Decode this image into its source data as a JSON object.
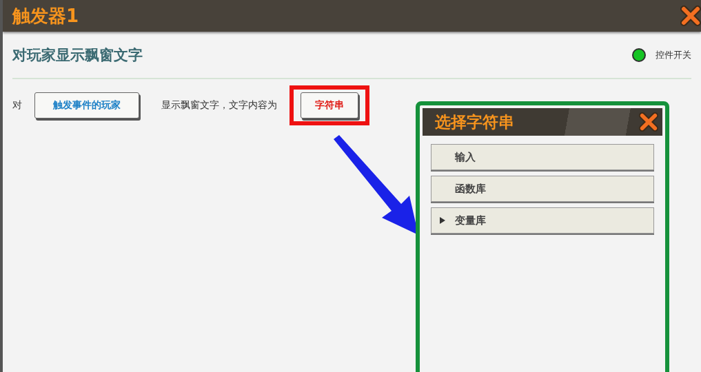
{
  "window": {
    "title": "触发器1"
  },
  "action": {
    "title": "对玩家显示飘窗文字",
    "toggle": {
      "label": "控件开关",
      "on": true
    }
  },
  "statement": [
    {
      "kind": "text",
      "text": "对"
    },
    {
      "kind": "param",
      "text": "触发事件的玩家",
      "highlighted": false
    },
    {
      "kind": "text",
      "text": "显示飘窗文字，文字内容为"
    },
    {
      "kind": "param",
      "text": "字符串",
      "highlighted": true
    }
  ],
  "popup": {
    "title": "选择字符串",
    "items": [
      {
        "label": "输入",
        "expandable": false
      },
      {
        "label": "函数库",
        "expandable": false
      },
      {
        "label": "变量库",
        "expandable": true
      }
    ]
  }
}
